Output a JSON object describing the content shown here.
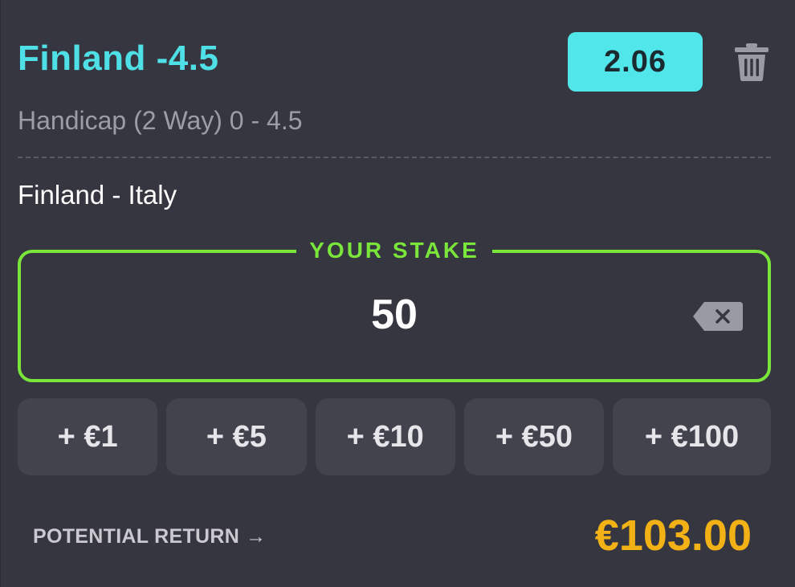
{
  "selection": {
    "title": "Finland -4.5",
    "odds": "2.06",
    "market": "Handicap (2 Way) 0 - 4.5",
    "event": "Finland - Italy"
  },
  "stake": {
    "label": "YOUR STAKE",
    "value": "50"
  },
  "quick_stakes": [
    "+ €1",
    "+ €5",
    "+ €10",
    "+ €50",
    "+ €100"
  ],
  "potential_return": {
    "label": "POTENTIAL RETURN",
    "arrow": "→",
    "value": "€103.00"
  },
  "icons": {
    "delete": "trash-icon",
    "clear": "backspace-icon"
  },
  "colors": {
    "background": "#363640",
    "accent_cyan": "#4ee0e6",
    "stake_green": "#7ae53a",
    "return_gold": "#f2b215"
  }
}
